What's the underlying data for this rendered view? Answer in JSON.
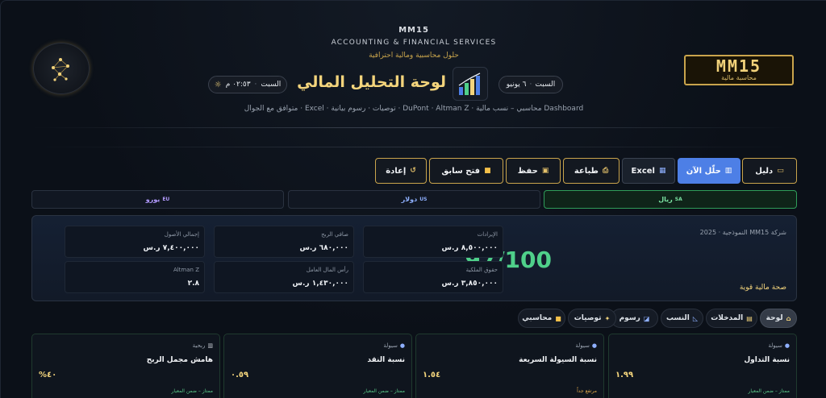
{
  "header": {
    "brand_code": "MM15",
    "brand_subtitle": "ACCOUNTING & FINANCIAL SERVICES",
    "brand_tagline": "حلول محاسبية ومالية احترافية",
    "logo_text": "MM15",
    "logo_subtext": "محاسبة مالية",
    "page_title": "لوحة التحليل المالي",
    "subtitle": "Dashboard محاسبي – نسب مالية · DuPont · Altman Z · توصيات · رسوم بيانية · Excel · متوافق مع الجوال",
    "date_day": "السبت",
    "date_value": "٦ يونيو",
    "time_day": "السبت",
    "time_value": "٠٢:٥٣ م"
  },
  "toolbar": {
    "guide": "دليل",
    "analyze": "حلّل الآن",
    "excel": "Excel",
    "print": "طباعة",
    "save": "حفظ",
    "open_prev": "فتح سابق",
    "reset": "إعادة"
  },
  "currencies": [
    {
      "code": "SA",
      "label": "ريال"
    },
    {
      "code": "US",
      "label": "دولار"
    },
    {
      "code": "EU",
      "label": "يورو"
    }
  ],
  "summary": {
    "company": "شركة MM15 النموذجية · 2025",
    "score": "97/100",
    "health": "صحة مالية قوية",
    "kpis": [
      {
        "label": "الإيرادات",
        "value": "٨,٥٠٠,٠٠٠ ر.س"
      },
      {
        "label": "صافي الربح",
        "value": "٦٨٠,٠٠٠ ر.س"
      },
      {
        "label": "إجمالي الأصول",
        "value": "٧,٤٠٠,٠٠٠ ر.س"
      },
      {
        "label": "حقوق الملكية",
        "value": "٣,٨٥٠,٠٠٠ ر.س"
      },
      {
        "label": "رأس المال العامل",
        "value": "١,٤٣٠,٠٠٠ ر.س"
      },
      {
        "label": "Altman Z",
        "value": "٢.٨"
      }
    ]
  },
  "sections": [
    "لوحة",
    "المدخلات",
    "النسب",
    "رسوم",
    "توصيات",
    "محاسبي"
  ],
  "cards": [
    {
      "category": "سيولة",
      "title": "نسبة التداول",
      "value": "١.٩٩",
      "status": "ممتاز – ضمن المعيار"
    },
    {
      "category": "سيولة",
      "title": "نسبة السيولة السريعة",
      "value": "١.٥٤",
      "status": "مرتفع جداً"
    },
    {
      "category": "سيولة",
      "title": "نسبة النقد",
      "value": "٠.٥٩",
      "status": "ممتاز – ضمن المعيار"
    },
    {
      "category": "ربحية",
      "title": "هامش مجمل الربح",
      "value": "٤٠%",
      "status": "ممتاز – ضمن المعيار"
    }
  ],
  "colors": {
    "gold": "#c9a44c",
    "primary_blue": "#4d7fe6",
    "score_green": "#4fd08a",
    "background": "#0b1018"
  }
}
